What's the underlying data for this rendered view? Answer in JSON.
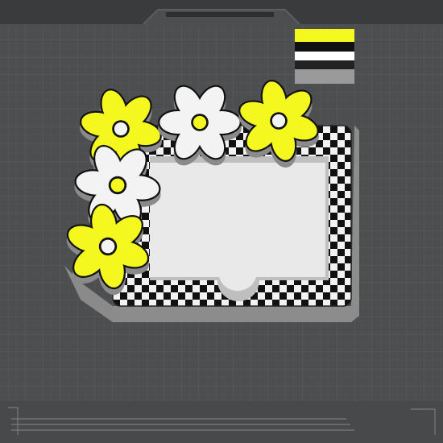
{
  "viewport": {
    "kind": "3d-slicer-build-plate",
    "background_color": "#3a3b3c",
    "plate_color": "#4d4e4f",
    "grid_color": "#626364"
  },
  "model": {
    "name": "checkered-daisy-photo-frame",
    "accent_yellow": "#f5f81e",
    "petal_white": "#f3f3f3",
    "outline_black": "#111111",
    "frame_white": "#ececec",
    "flowers": [
      {
        "id": "flower-yellow-top-left",
        "color": "yellow"
      },
      {
        "id": "flower-white-top-middle",
        "color": "white"
      },
      {
        "id": "flower-yellow-top-right",
        "color": "yellow"
      },
      {
        "id": "flower-white-left-middle",
        "color": "white"
      },
      {
        "id": "flower-yellow-bottom-left",
        "color": "yellow"
      }
    ]
  },
  "color_swatch": {
    "colors": [
      "#f5f81e",
      "#111111",
      "#ffffff",
      "#222222"
    ]
  }
}
